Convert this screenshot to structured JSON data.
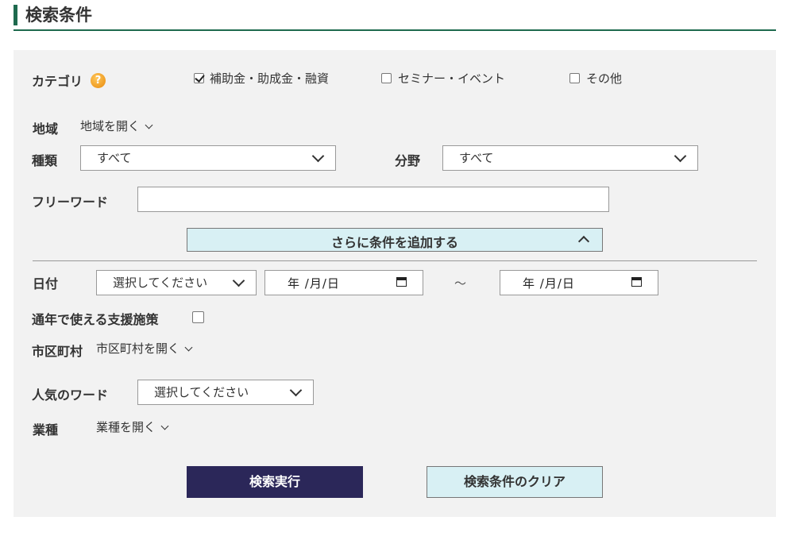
{
  "section": {
    "title": "検索条件"
  },
  "category": {
    "label": "カテゴリ",
    "help_icon": "?",
    "options": [
      {
        "label": "補助金・助成金・融資",
        "checked": true
      },
      {
        "label": "セミナー・イベント",
        "checked": false
      },
      {
        "label": "その他",
        "checked": false
      }
    ]
  },
  "region": {
    "label": "地域",
    "toggle": "地域を開く"
  },
  "type": {
    "label": "種類",
    "selected": "すべて"
  },
  "field": {
    "label": "分野",
    "selected": "すべて"
  },
  "freeword": {
    "label": "フリーワード",
    "value": ""
  },
  "more": {
    "label": "さらに条件を追加する"
  },
  "date": {
    "label": "日付",
    "select": "選択してください",
    "from": "年 /月/日",
    "separator": "～",
    "to": "年 /月/日"
  },
  "yearround": {
    "label": "通年で使える支援施策",
    "checked": false
  },
  "city": {
    "label": "市区町村",
    "toggle": "市区町村を開く"
  },
  "popular": {
    "label": "人気のワード",
    "select": "選択してください"
  },
  "industry": {
    "label": "業種",
    "toggle": "業種を開く"
  },
  "actions": {
    "search": "検索実行",
    "clear": "検索条件のクリア"
  },
  "colors": {
    "accent": "#1e6a4e",
    "primary_button": "#2b2759",
    "secondary_button": "#d8f0f4",
    "panel": "#f2f2f2"
  },
  "icons": {
    "help": "question-circle-icon",
    "dropdown": "chevron-down-icon",
    "collapse": "chevron-up-icon",
    "calendar": "calendar-icon"
  }
}
